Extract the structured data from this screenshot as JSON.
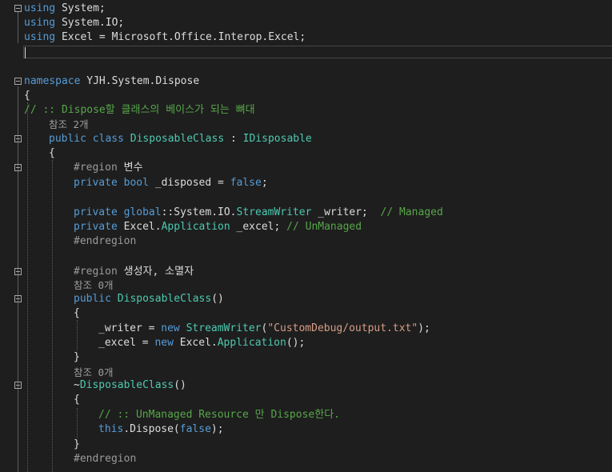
{
  "editor": {
    "lines": [
      {
        "fold": true,
        "tokens": [
          [
            "kw",
            "using"
          ],
          [
            "tx",
            " System;"
          ]
        ]
      },
      {
        "fold": false,
        "tokens": [
          [
            "kw",
            "using"
          ],
          [
            "tx",
            " System.IO;"
          ]
        ]
      },
      {
        "fold": false,
        "tokens": [
          [
            "kw",
            "using"
          ],
          [
            "tx",
            " Excel = Microsoft.Office.Interop.Excel;"
          ]
        ]
      },
      {
        "fold": false,
        "tokens": []
      },
      {
        "fold": false,
        "tokens": []
      },
      {
        "fold": true,
        "tokens": [
          [
            "kw",
            "namespace"
          ],
          [
            "tx",
            " YJH.System.Dispose"
          ]
        ]
      },
      {
        "fold": false,
        "tokens": [
          [
            "tx",
            "{"
          ]
        ]
      },
      {
        "fold": false,
        "tokens": [
          [
            "cm",
            "// :: Dispose할 클래스의 베이스가 되는 뼈대"
          ]
        ]
      },
      {
        "fold": false,
        "tokens": [
          [
            "ref",
            "참조 2개"
          ]
        ]
      },
      {
        "fold": true,
        "tokens": [
          [
            "kw",
            "public"
          ],
          [
            "tx",
            " "
          ],
          [
            "kw",
            "class"
          ],
          [
            "tx",
            " "
          ],
          [
            "ty",
            "DisposableClass"
          ],
          [
            "tx",
            " : "
          ],
          [
            "ty",
            "IDisposable"
          ]
        ]
      },
      {
        "fold": false,
        "tokens": [
          [
            "tx",
            "{"
          ]
        ]
      },
      {
        "fold": true,
        "tokens": [
          [
            "pp",
            "#region"
          ],
          [
            "tx",
            " 변수"
          ]
        ]
      },
      {
        "fold": false,
        "tokens": [
          [
            "kw",
            "private"
          ],
          [
            "tx",
            " "
          ],
          [
            "kw",
            "bool"
          ],
          [
            "tx",
            " _disposed = "
          ],
          [
            "kw",
            "false"
          ],
          [
            "tx",
            ";"
          ]
        ]
      },
      {
        "fold": false,
        "tokens": []
      },
      {
        "fold": false,
        "tokens": [
          [
            "kw",
            "private"
          ],
          [
            "tx",
            " "
          ],
          [
            "kw",
            "global"
          ],
          [
            "tx",
            "::System.IO."
          ],
          [
            "ty",
            "StreamWriter"
          ],
          [
            "tx",
            " _writer;  "
          ],
          [
            "cm",
            "// Managed"
          ]
        ]
      },
      {
        "fold": false,
        "tokens": [
          [
            "kw",
            "private"
          ],
          [
            "tx",
            " Excel."
          ],
          [
            "ty",
            "Application"
          ],
          [
            "tx",
            " _excel; "
          ],
          [
            "cm",
            "// UnManaged"
          ]
        ]
      },
      {
        "fold": false,
        "tokens": [
          [
            "pp",
            "#endregion"
          ]
        ]
      },
      {
        "fold": false,
        "tokens": []
      },
      {
        "fold": true,
        "tokens": [
          [
            "pp",
            "#region"
          ],
          [
            "tx",
            " 생성자, 소멸자"
          ]
        ]
      },
      {
        "fold": false,
        "tokens": [
          [
            "ref",
            "참조 0개"
          ]
        ]
      },
      {
        "fold": true,
        "tokens": [
          [
            "kw",
            "public"
          ],
          [
            "tx",
            " "
          ],
          [
            "ty",
            "DisposableClass"
          ],
          [
            "tx",
            "()"
          ]
        ]
      },
      {
        "fold": false,
        "tokens": [
          [
            "tx",
            "{"
          ]
        ]
      },
      {
        "fold": false,
        "tokens": [
          [
            "tx",
            "_writer = "
          ],
          [
            "kw",
            "new"
          ],
          [
            "tx",
            " "
          ],
          [
            "ty",
            "StreamWriter"
          ],
          [
            "tx",
            "("
          ],
          [
            "st",
            "\"CustomDebug/output.txt\""
          ],
          [
            "tx",
            ");"
          ]
        ]
      },
      {
        "fold": false,
        "tokens": [
          [
            "tx",
            "_excel = "
          ],
          [
            "kw",
            "new"
          ],
          [
            "tx",
            " Excel."
          ],
          [
            "ty",
            "Application"
          ],
          [
            "tx",
            "();"
          ]
        ]
      },
      {
        "fold": false,
        "tokens": [
          [
            "tx",
            "}"
          ]
        ]
      },
      {
        "fold": false,
        "tokens": [
          [
            "ref",
            "참조 0개"
          ]
        ]
      },
      {
        "fold": true,
        "tokens": [
          [
            "tx",
            "~"
          ],
          [
            "ty",
            "DisposableClass"
          ],
          [
            "tx",
            "()"
          ]
        ]
      },
      {
        "fold": false,
        "tokens": [
          [
            "tx",
            "{"
          ]
        ]
      },
      {
        "fold": false,
        "tokens": [
          [
            "cm",
            "// :: UnManaged Resource 만 Dispose한다."
          ]
        ]
      },
      {
        "fold": false,
        "tokens": [
          [
            "kw",
            "this"
          ],
          [
            "tx",
            ".Dispose("
          ],
          [
            "kw",
            "false"
          ],
          [
            "tx",
            ");"
          ]
        ]
      },
      {
        "fold": false,
        "tokens": [
          [
            "tx",
            "}"
          ]
        ]
      },
      {
        "fold": false,
        "tokens": [
          [
            "pp",
            "#endregion"
          ]
        ]
      }
    ]
  },
  "colors": {
    "background": "#1e1e1e",
    "keyword": "#569cd6",
    "type": "#4ec9b0",
    "comment": "#57a64a",
    "string": "#d69d85",
    "preprocessor": "#9b9b9b",
    "text": "#dcdcdc"
  }
}
